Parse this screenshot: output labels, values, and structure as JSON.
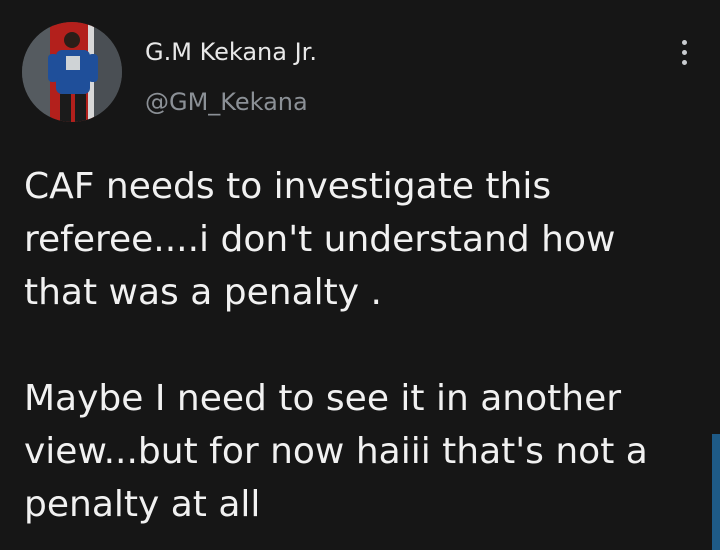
{
  "author": {
    "display_name": "G.M Kekana Jr.",
    "handle": "@GM_Kekana",
    "avatar_icon": "profile-photo"
  },
  "menu": {
    "icon": "more-vertical-icon"
  },
  "tweet": {
    "paragraphs": [
      "CAF needs to investigate this\nreferee....i don't understand how\nthat was a penalty .",
      "Maybe I need to see it in another\nview...but for now haiii that's not a\npenalty at all"
    ]
  },
  "colors": {
    "background": "#161616",
    "text": "#f1f1f1",
    "handle": "#8b9096",
    "accent_edge": "#1e5a86"
  }
}
